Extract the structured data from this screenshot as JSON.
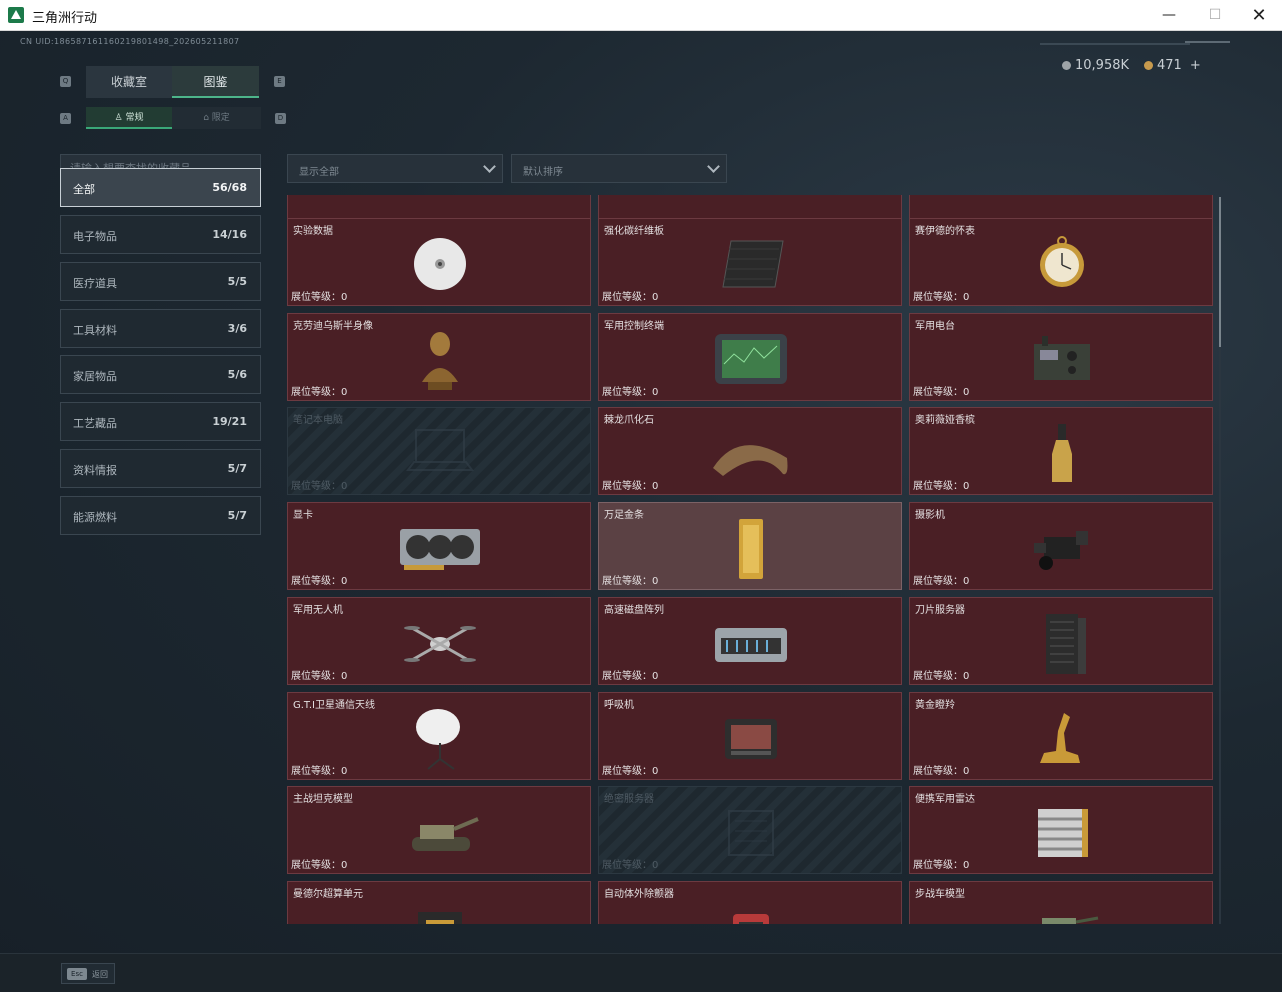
{
  "window": {
    "title": "三角洲行动",
    "minimize": "—",
    "maximize": "☐",
    "close": "✕"
  },
  "uid": "CN UID:18658716116021980149​8_20260521​1807",
  "currency": {
    "silver": "10,958K",
    "gold": "471",
    "add": "+"
  },
  "tabs": {
    "left_key": "Q",
    "right_key": "E",
    "items": [
      {
        "label": "收藏室",
        "active": false
      },
      {
        "label": "图鉴",
        "active": true
      }
    ]
  },
  "subtabs": {
    "left_key": "A",
    "right_key": "D",
    "items": [
      {
        "label": "常规",
        "active": true
      },
      {
        "label": "限定",
        "active": false
      }
    ]
  },
  "search": {
    "placeholder": "请输入想要查找的收藏品"
  },
  "filters": {
    "display": "显示全部",
    "sort": "默认排序"
  },
  "categories": [
    {
      "name": "全部",
      "count": "56/68",
      "active": true
    },
    {
      "name": "电子物品",
      "count": "14/16",
      "active": false
    },
    {
      "name": "医疗道具",
      "count": "5/5",
      "active": false
    },
    {
      "name": "工具材料",
      "count": "3/6",
      "active": false
    },
    {
      "name": "家居物品",
      "count": "5/6",
      "active": false
    },
    {
      "name": "工艺藏品",
      "count": "19/21",
      "active": false
    },
    {
      "name": "资料情报",
      "count": "5/7",
      "active": false
    },
    {
      "name": "能源燃料",
      "count": "5/7",
      "active": false
    }
  ],
  "level_label": "展位等级：0",
  "items": [
    {
      "name": "",
      "state": "normal",
      "icon": ""
    },
    {
      "name": "",
      "state": "normal",
      "icon": ""
    },
    {
      "name": "",
      "state": "normal",
      "icon": ""
    },
    {
      "name": "实验数据",
      "state": "normal",
      "icon": "disc-icon"
    },
    {
      "name": "强化碳纤维板",
      "state": "normal",
      "icon": "carbon-plate-icon"
    },
    {
      "name": "赛伊德的怀表",
      "state": "normal",
      "icon": "pocket-watch-icon"
    },
    {
      "name": "克劳迪乌斯半身像",
      "state": "normal",
      "icon": "bust-icon"
    },
    {
      "name": "军用控制终端",
      "state": "normal",
      "icon": "terminal-icon"
    },
    {
      "name": "军用电台",
      "state": "normal",
      "icon": "radio-icon"
    },
    {
      "name": "笔记本电脑",
      "state": "locked",
      "icon": "laptop-icon"
    },
    {
      "name": "棘龙爪化石",
      "state": "normal",
      "icon": "claw-fossil-icon"
    },
    {
      "name": "奥莉薇娅香槟",
      "state": "normal",
      "icon": "champagne-icon"
    },
    {
      "name": "显卡",
      "state": "normal",
      "icon": "gpu-icon"
    },
    {
      "name": "万足金条",
      "state": "highlight",
      "icon": "gold-bar-icon"
    },
    {
      "name": "摄影机",
      "state": "normal",
      "icon": "camera-icon"
    },
    {
      "name": "军用无人机",
      "state": "normal",
      "icon": "drone-icon"
    },
    {
      "name": "高速磁盘阵列",
      "state": "normal",
      "icon": "disk-array-icon"
    },
    {
      "name": "刀片服务器",
      "state": "normal",
      "icon": "blade-server-icon"
    },
    {
      "name": "G.T.I卫星通信天线",
      "state": "normal",
      "icon": "satellite-dish-icon"
    },
    {
      "name": "呼吸机",
      "state": "normal",
      "icon": "ventilator-icon"
    },
    {
      "name": "黄金瞪羚",
      "state": "normal",
      "icon": "gold-gazelle-icon"
    },
    {
      "name": "主战坦克模型",
      "state": "normal",
      "icon": "tank-icon"
    },
    {
      "name": "绝密服务器",
      "state": "locked",
      "icon": "server-icon"
    },
    {
      "name": "便携军用雷达",
      "state": "normal",
      "icon": "radar-icon"
    },
    {
      "name": "曼德尔超算单元",
      "state": "normal",
      "icon": "compute-unit-icon"
    },
    {
      "name": "自动体外除颤器",
      "state": "normal",
      "icon": "defibrillator-icon"
    },
    {
      "name": "步战车模型",
      "state": "normal",
      "icon": "ifv-icon"
    }
  ],
  "bottom": {
    "esc_key": "Esc",
    "esc_label": "返回"
  },
  "colors": {
    "card_bg": "#4a1f25",
    "accent": "#4db58a"
  }
}
